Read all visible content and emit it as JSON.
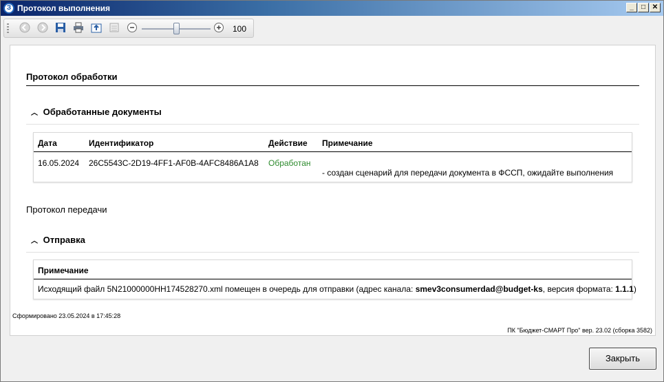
{
  "window": {
    "title": "Протокол выполнения",
    "app_icon": "З",
    "minimize_glyph": "_",
    "maximize_glyph": "□",
    "close_glyph": "✕"
  },
  "toolbar": {
    "back_icon": "⊖",
    "forward_icon": "⊕",
    "zoom_out_icon": "⊖",
    "zoom_in_icon": "⊕",
    "zoom_value": "100"
  },
  "report": {
    "heading": "Протокол обработки",
    "processed_section": {
      "title": "Обработанные документы",
      "columns": [
        "Дата",
        "Идентификатор",
        "Действие",
        "Примечание"
      ],
      "rows": [
        {
          "date": "16.05.2024",
          "id": "26C5543C-2D19-4FF1-AF0B-4AFC8486A1A8",
          "action": "Обработан",
          "note": "- создан сценарий для передачи документа в ФССП, ожидайте выполнения"
        }
      ]
    },
    "transfer_label": "Протокол передачи",
    "send_section": {
      "title": "Отправка",
      "column": "Примечание",
      "note_prefix": "Исходящий файл 5N21000000HH174528270.xml помещен в очередь для отправки (адрес канала: ",
      "channel": "smev3consumerdad@budget-ks",
      "note_middle": ", версия формата: ",
      "format_version": "1.1.1",
      "note_suffix": ")"
    },
    "generated": "Сформировано 23.05.2024 в 17:45:28",
    "product": "ПК \"Бюджет-СМАРТ Про\" вер. 23.02 (сборка 3582)"
  },
  "footer": {
    "close_label": "Закрыть"
  }
}
